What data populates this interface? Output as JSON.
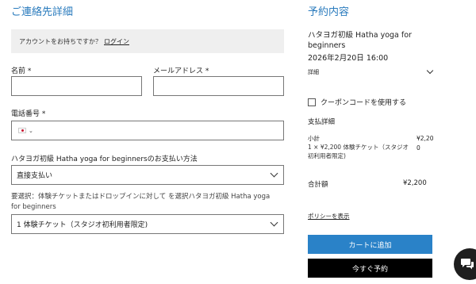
{
  "contact": {
    "heading": "ご連絡先詳細",
    "login_prompt": "アカウントをお持ちですか？",
    "login_link": "ログイン",
    "name_label": "名前 *",
    "email_label": "メールアドレス *",
    "phone_label": "電話番号 *",
    "payment_question": "ハタヨガ初級 Hatha yoga for beginnersのお支払い方法",
    "payment_selected": "直接支払い",
    "note": "要選択：体験チケットまたはドロップインに対して を選択ハタヨガ初級 Hatha yoga for beginners",
    "ticket_selected": "1 体験チケット（スタジオ初利用者限定)"
  },
  "summary": {
    "heading": "予約内容",
    "class_title": "ハタヨガ初級 Hatha yoga for beginners",
    "class_date": "2026年2月20日 16:00",
    "details_label": "詳細",
    "coupon_label": "クーポンコードを使用する",
    "payment_details_heading": "支払詳細",
    "subtotal_label": "小計",
    "subtotal_value": "¥2,200",
    "item_line": "1 × ¥2,200 体験チケット（スタジオ初利用者限定)",
    "total_label": "合計額",
    "total_value": "¥2,200",
    "policy_link": "ポリシーを表示",
    "add_to_cart": "カートに追加",
    "book_now": "今すぐ予約"
  },
  "colors": {
    "accent": "#2a7bbd",
    "primary_button": "#2a82c8",
    "secondary_button": "#000000"
  },
  "icons": {
    "phone_country": "japan-flag-icon",
    "chat": "chat-bubble-icon"
  }
}
